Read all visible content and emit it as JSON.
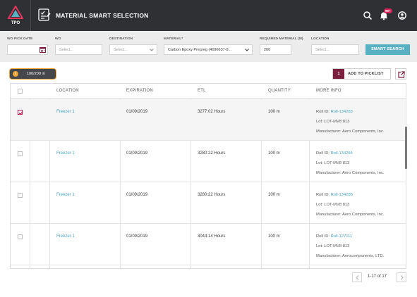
{
  "header": {
    "logo_text": "TPO",
    "title": "MATERIAL SMART SELECTION",
    "notification_badge": "99+",
    "icons": [
      "search-icon",
      "bell-icon",
      "user-icon"
    ]
  },
  "filters": {
    "wo_pick_date": {
      "label": "WO PICK DATE",
      "value": ""
    },
    "wo": {
      "label": "WO",
      "placeholder": "Select..."
    },
    "destination": {
      "label": "DESTINATION",
      "placeholder": "Select..."
    },
    "material": {
      "label": "MATERIAL*",
      "value": "Carbon Epoxy Prepreg (4096637-9..."
    },
    "required_material": {
      "label": "REQUIRED MATERIAL (M)",
      "value": "200"
    },
    "location": {
      "label": "LOCATION",
      "placeholder": "Select..."
    },
    "smart_search_label": "SMART SEARCH"
  },
  "toolbar": {
    "progress_text": "100/200 m",
    "info_icon": "i",
    "picklist_count": "1",
    "add_to_picklist_label": "ADD TO PICKLIST"
  },
  "table": {
    "columns": [
      "LOCATION",
      "EXPIRATION",
      "ETL",
      "QUANTITY",
      "MORE INFO"
    ],
    "rows": [
      {
        "checked": true,
        "location": "Freezer 1",
        "expiration": "01/09/2019",
        "etl": "3277:02 Hours",
        "quantity": "100 m",
        "roll_label": "Roll ID:",
        "roll_id": "Roll-134283",
        "lot": "Lot: LOT-MV8 813",
        "manufacturer": "Manufacturer: Aero Components, Inc."
      },
      {
        "checked": false,
        "location": "Freezer 1",
        "expiration": "01/09/2019",
        "etl": "3280:22 Hours",
        "quantity": "100 m",
        "roll_label": "Roll ID:",
        "roll_id": "Roll-134284",
        "lot": "Lot: LOT-MV8 813",
        "manufacturer": "Manufacturer: Aero Components, Inc."
      },
      {
        "checked": false,
        "location": "Freezer 1",
        "expiration": "01/09/2019",
        "etl": "3280:22 Hours",
        "quantity": "100 m",
        "roll_label": "Roll ID:",
        "roll_id": "Roll-134285",
        "lot": "Lot: LOT-MV8 813",
        "manufacturer": "Manufacturer: Aero Components, Inc."
      },
      {
        "checked": false,
        "location": "Freezer 1",
        "expiration": "01/09/2019",
        "etl": "3044:14 Hours",
        "quantity": "100 m",
        "roll_label": "Roll ID:",
        "roll_id": "Roll-127111",
        "lot": "Lot: LOT-MV8 813",
        "manufacturer": "Manufacturer: Aerocomponents, LTD."
      }
    ]
  },
  "pagination": {
    "text": "1-17 of 17"
  },
  "colors": {
    "header_bg": "#2f3034",
    "accent": "#58b1c3",
    "brand": "#7a1f3d",
    "warning": "#f0a234",
    "link": "#4aa3c2"
  }
}
